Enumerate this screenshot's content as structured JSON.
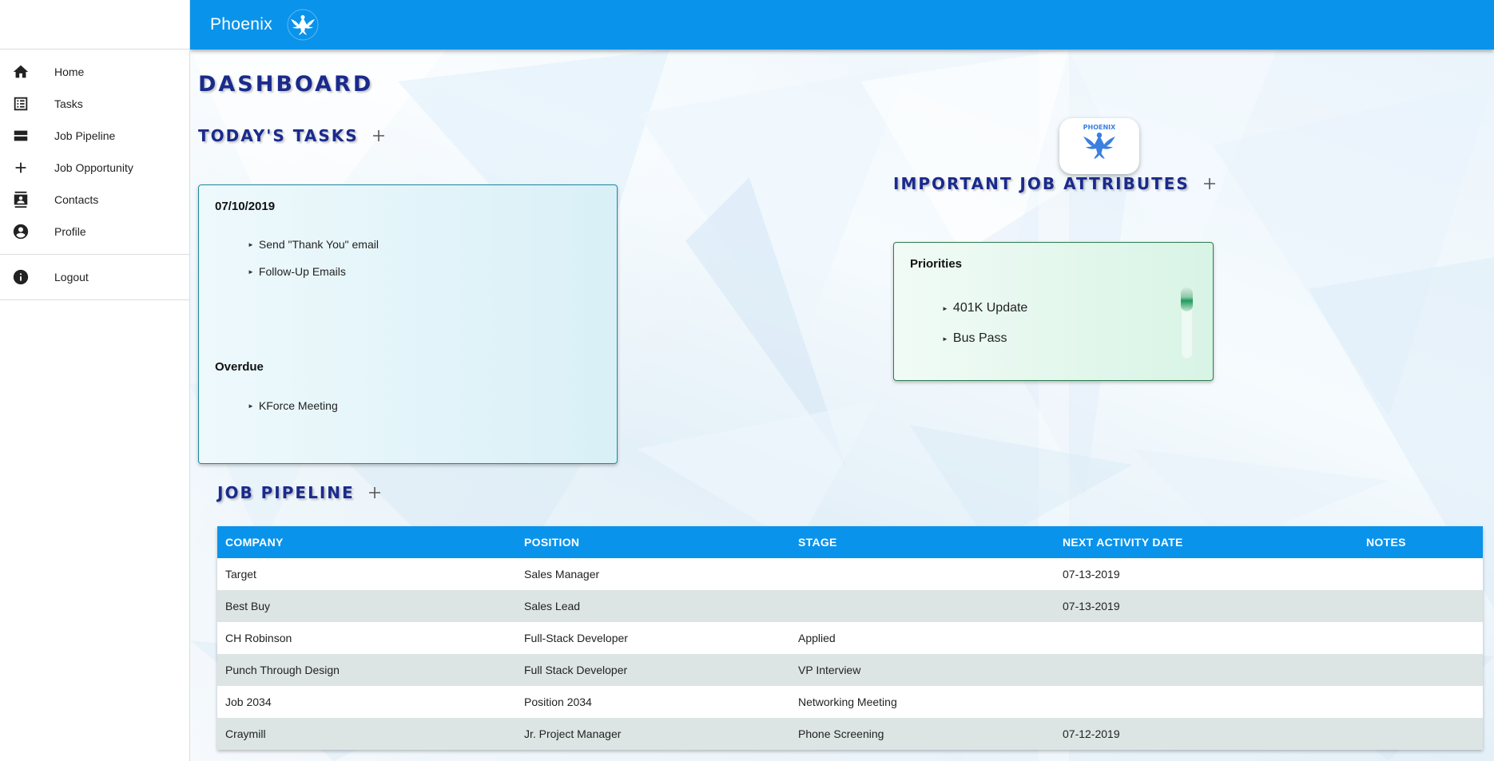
{
  "app": {
    "title": "Phoenix",
    "logo_icon": "phoenix-bird-icon"
  },
  "sidebar": {
    "items": [
      {
        "label": "Home",
        "icon": "home-icon"
      },
      {
        "label": "Tasks",
        "icon": "list-icon"
      },
      {
        "label": "Job Pipeline",
        "icon": "view-stream-icon"
      },
      {
        "label": "Job Opportunity",
        "icon": "plus-icon"
      },
      {
        "label": "Contacts",
        "icon": "contacts-icon"
      },
      {
        "label": "Profile",
        "icon": "account-circle-icon"
      }
    ],
    "logout": {
      "label": "Logout",
      "icon": "info-icon"
    }
  },
  "dashboard": {
    "title": "DASHBOARD",
    "tasks": {
      "heading": "TODAY'S TASKS",
      "date": "07/10/2019",
      "today_items": [
        "Send \"Thank You\" email",
        "Follow-Up Emails"
      ],
      "overdue_label": "Overdue",
      "overdue_items": [
        "KForce Meeting"
      ]
    },
    "badge": {
      "text": "PHOENIX"
    },
    "attributes": {
      "heading": "IMPORTANT JOB ATTRIBUTES",
      "subheading": "Priorities",
      "items": [
        "401K Update",
        "Bus Pass"
      ]
    },
    "pipeline": {
      "heading": "JOB PIPELINE",
      "columns": [
        "COMPANY",
        "POSITION",
        "STAGE",
        "NEXT ACTIVITY DATE",
        "NOTES"
      ],
      "rows": [
        [
          "Target",
          "Sales Manager",
          "",
          "07-13-2019",
          ""
        ],
        [
          "Best Buy",
          "Sales Lead",
          "",
          "07-13-2019",
          ""
        ],
        [
          "CH Robinson",
          "Full-Stack Developer",
          "Applied",
          "",
          ""
        ],
        [
          "Punch Through Design",
          "Full Stack Developer",
          "VP Interview",
          "",
          ""
        ],
        [
          "Job 2034",
          "Position 2034",
          "Networking Meeting",
          "",
          ""
        ],
        [
          "Craymill",
          "Jr. Project Manager",
          "Phone Screening",
          "07-12-2019",
          ""
        ]
      ]
    }
  },
  "colors": {
    "appbar": "#0a93eb",
    "heading": "#1a2a8c",
    "tasks_card_border": "#1e8aa0",
    "attributes_card_border": "#2f7d4e",
    "row_alt": "#dde4e4"
  }
}
